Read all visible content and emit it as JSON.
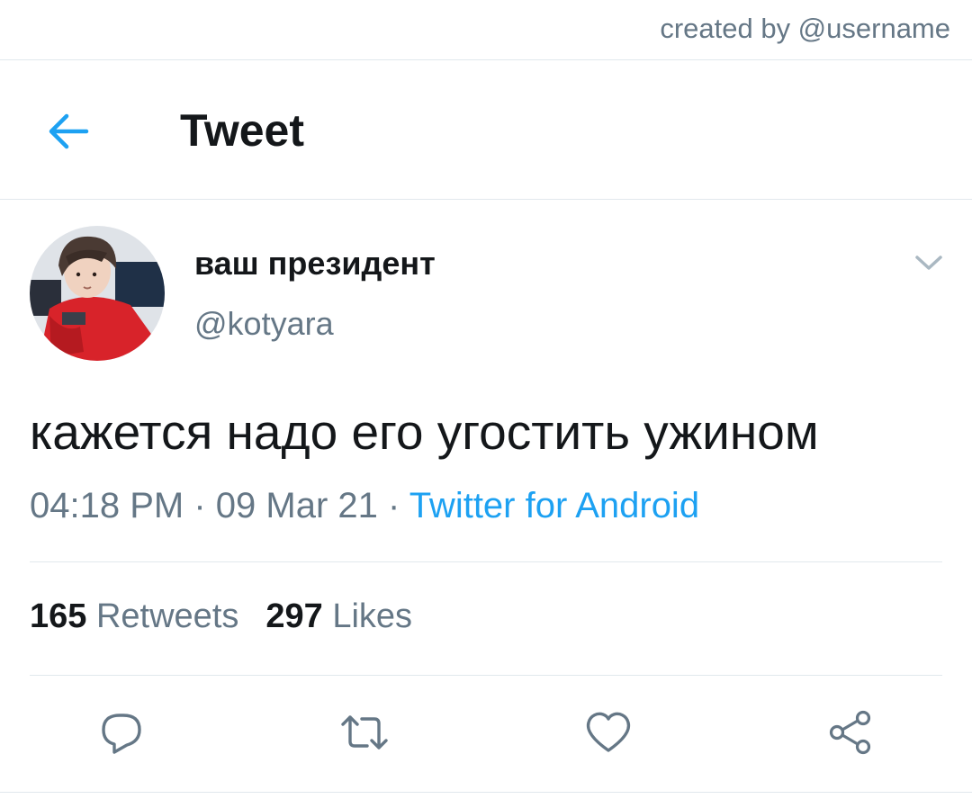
{
  "credit": "created by @username",
  "header": {
    "title": "Tweet",
    "back_icon": "arrow-left-icon"
  },
  "tweet": {
    "display_name": "ваш президент",
    "handle": "@kotyara",
    "text": "кажется надо его угостить ужином",
    "time": "04:18 PM",
    "sep1": " · ",
    "date": "09 Mar 21",
    "sep2": " · ",
    "source": "Twitter for Android"
  },
  "stats": {
    "retweets_count": "165",
    "retweets_label": "Retweets",
    "likes_count": "297",
    "likes_label": "Likes"
  },
  "actions": {
    "reply_icon": "reply-icon",
    "retweet_icon": "retweet-icon",
    "like_icon": "heart-icon",
    "share_icon": "share-icon"
  },
  "colors": {
    "accent": "#1da1f2",
    "text": "#14171a",
    "secondary": "#657786",
    "divider": "#e1e8ed"
  }
}
